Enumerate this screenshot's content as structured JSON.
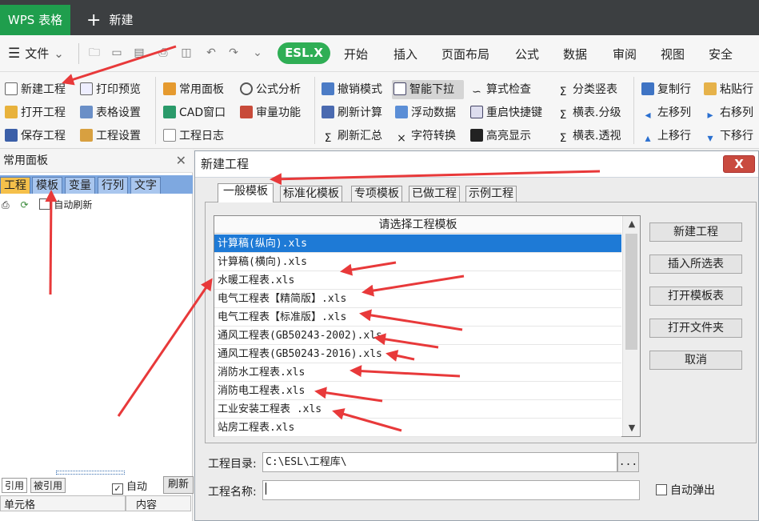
{
  "titlebar": {
    "app_tab": "WPS 表格",
    "new_tab": "新建"
  },
  "menubar": {
    "file": "文件",
    "esl": "ESL.X",
    "tabs": [
      "开始",
      "插入",
      "页面布局",
      "公式",
      "数据",
      "审阅",
      "视图",
      "安全"
    ]
  },
  "ribbon": {
    "col1": [
      "新建工程",
      "打开工程",
      "保存工程"
    ],
    "col2": [
      "打印预览",
      "表格设置",
      "工程设置"
    ],
    "col3": [
      "常用面板",
      "CAD窗口",
      "工程日志"
    ],
    "col4": [
      "公式分析",
      "审量功能"
    ],
    "col5": [
      "撤销模式",
      "刷新计算",
      "刷新汇总"
    ],
    "col6": [
      "智能下拉",
      "浮动数据",
      "字符转换"
    ],
    "col7": [
      "算式检查",
      "重启快捷键",
      "高亮显示"
    ],
    "col8": [
      "分类竖表",
      "横表.分级",
      "横表.透视"
    ],
    "col9": [
      "复制行",
      "左移列",
      "上移行"
    ],
    "col10": [
      "粘贴行",
      "右移列",
      "下移行"
    ]
  },
  "left_panel": {
    "title": "常用面板",
    "tabs": [
      "工程",
      "模板",
      "变量",
      "行列",
      "文字"
    ],
    "auto_refresh": "自动刷新",
    "bottom_tabs": [
      "引用",
      "被引用"
    ],
    "auto": "自动",
    "refresh": "刷新",
    "col_cell": "单元格",
    "col_content": "内容"
  },
  "dialog": {
    "title": "新建工程",
    "close": "X",
    "tabs": [
      "一般模板",
      "标准化模板",
      "专项模板",
      "已做工程",
      "示例工程"
    ],
    "list_header": "请选择工程模板",
    "templates": [
      "计算稿(纵向).xls",
      "计算稿(横向).xls",
      "水暖工程表.xls",
      "电气工程表【精简版】.xls",
      "电气工程表【标准版】.xls",
      "通风工程表(GB50243-2002).xls",
      "通风工程表(GB50243-2016).xls",
      "消防水工程表.xls",
      "消防电工程表.xls",
      "工业安装工程表 .xls",
      "站房工程表.xls"
    ],
    "selected_index": 0,
    "buttons": [
      "新建工程",
      "插入所选表",
      "打开模板表",
      "打开文件夹",
      "取消"
    ],
    "dir_label": "工程目录:",
    "dir_value": "C:\\ESL\\工程库\\",
    "browse": "...",
    "name_label": "工程名称:",
    "name_value": "",
    "auto_popup": "自动弹出"
  },
  "colors": {
    "accent_green": "#2fae55",
    "selection": "#1e7ad6",
    "annotation_arrow": "#e8393a"
  }
}
